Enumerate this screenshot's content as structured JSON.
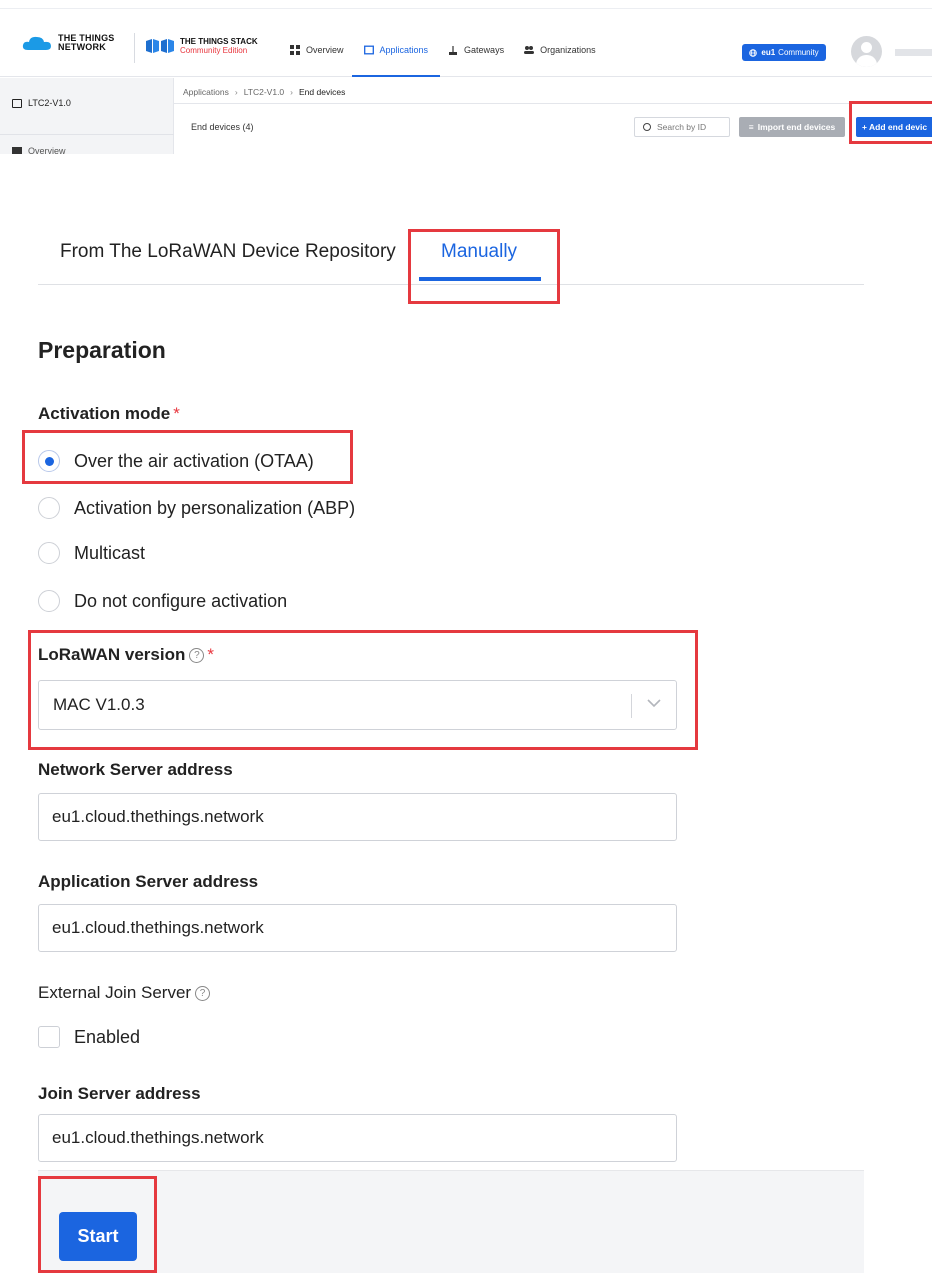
{
  "header": {
    "ttn_logo_line1": "THE THINGS",
    "ttn_logo_line2": "NETWORK",
    "tts_logo_line1": "THE THINGS STACK",
    "tts_logo_line2": "Community Edition",
    "nav": [
      {
        "label": "Overview",
        "icon": "grid-icon"
      },
      {
        "label": "Applications",
        "icon": "application-icon",
        "active": true
      },
      {
        "label": "Gateways",
        "icon": "gateway-icon"
      },
      {
        "label": "Organizations",
        "icon": "organizations-icon"
      }
    ],
    "cluster_region": "eu1",
    "cluster_label": "Community"
  },
  "sidebar": {
    "app_name": "LTC2-V1.0",
    "overview_label": "Overview"
  },
  "breadcrumb": {
    "items": [
      "Applications",
      "LTC2-V1.0",
      "End devices"
    ],
    "separator": "›"
  },
  "end_devices": {
    "title": "End devices (4)",
    "search_placeholder": "Search by ID",
    "import_label": "Import end devices",
    "add_label": "+ Add end devic"
  },
  "tabs": {
    "repository": "From The LoRaWAN Device Repository",
    "manually": "Manually"
  },
  "form": {
    "section_title": "Preparation",
    "activation_label": "Activation mode",
    "required_mark": "*",
    "activation_options": [
      {
        "label": "Over the air activation (OTAA)",
        "checked": true
      },
      {
        "label": "Activation by personalization (ABP)",
        "checked": false
      },
      {
        "label": "Multicast",
        "checked": false
      },
      {
        "label": "Do not configure activation",
        "checked": false
      }
    ],
    "lorawan_label": "LoRaWAN version",
    "help_glyph": "?",
    "lorawan_value": "MAC V1.0.3",
    "ns_label": "Network Server address",
    "ns_value": "eu1.cloud.thethings.network",
    "as_label": "Application Server address",
    "as_value": "eu1.cloud.thethings.network",
    "ejs_label": "External Join Server",
    "ejs_checkbox": "Enabled",
    "js_label": "Join Server address",
    "js_value": "eu1.cloud.thethings.network",
    "start_label": "Start"
  },
  "colors": {
    "accent": "#1b65e0",
    "highlight": "#e5393f",
    "required": "#e8363e"
  }
}
